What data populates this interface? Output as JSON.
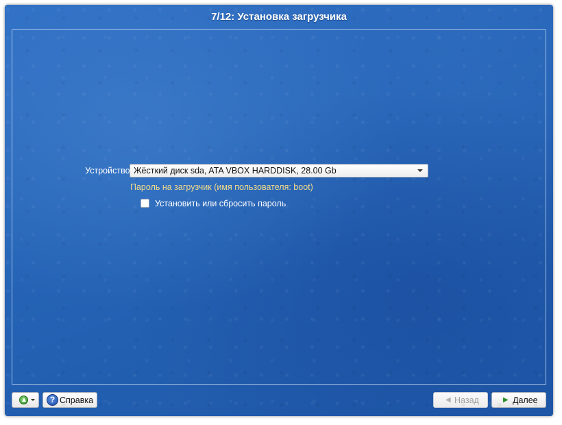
{
  "window": {
    "title": "7/12: Установка загрузчика"
  },
  "form": {
    "device_label": "Устройство:",
    "device_value": "Жёсткий диск sda, ATA VBOX HARDDISK, 28.00 Gb",
    "password_hint": "Пароль на загрузчик (имя пользователя: boot)",
    "set_password_label": "Установить или сбросить пароль",
    "set_password_checked": false
  },
  "footer": {
    "lang_icon": "up-arrow-circle-icon",
    "help_icon": "question-circle-icon",
    "help_label": "Справка",
    "back_icon": "chevron-left-icon",
    "back_label": "Назад",
    "back_enabled": false,
    "next_icon": "chevron-right-icon",
    "next_label": "Далее"
  },
  "colors": {
    "background": "#2563b6",
    "hint_text": "#f2dc8a",
    "next_chevron": "#2f8f2a"
  }
}
